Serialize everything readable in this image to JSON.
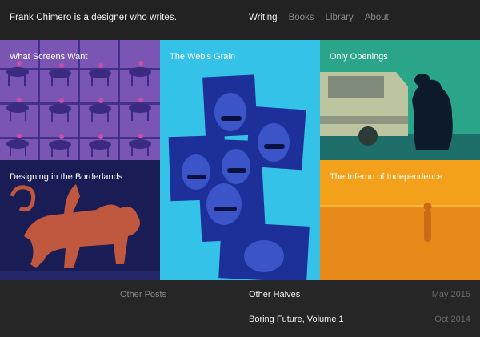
{
  "header": {
    "site_title": "Frank Chimero is a designer who writes.",
    "nav": [
      "Writing",
      "Books",
      "Library",
      "About"
    ],
    "active_nav": "Writing"
  },
  "tiles": [
    {
      "title": "What Screens Want",
      "color": "#6e4fa8",
      "image": "horse-motion-photo"
    },
    {
      "title": "The Web's Grain",
      "color": "#34c2e8",
      "image": "man-with-sunglasses-collage"
    },
    {
      "title": "Only Openings",
      "color": "#1f9f82",
      "image": "bear-and-car-photo"
    },
    {
      "title": "Designing in the Borderlands",
      "color": "#1a1d55",
      "image": "chimera-statue-photo"
    },
    {
      "title": "The Inferno of Independence",
      "color": "#f3961b",
      "image": "desert-figure-photo"
    }
  ],
  "other_posts": {
    "label": "Other Posts",
    "posts": [
      {
        "title": "Other Halves",
        "date": "May 2015"
      },
      {
        "title": "Boring Future, Volume 1",
        "date": "Oct 2014"
      }
    ]
  }
}
